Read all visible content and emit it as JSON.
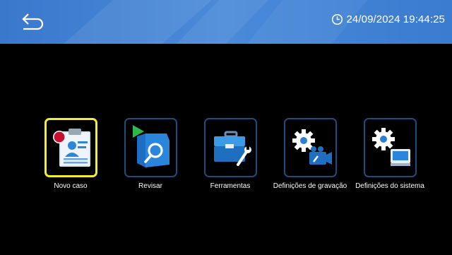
{
  "header": {
    "datetime": "24/09/2024 19:44:25"
  },
  "menu": {
    "items": [
      {
        "label": "Novo caso",
        "icon": "new-case-icon",
        "selected": true
      },
      {
        "label": "Revisar",
        "icon": "review-play-search-icon",
        "selected": false
      },
      {
        "label": "Ferramentas",
        "icon": "toolbox-wrench-icon",
        "selected": false
      },
      {
        "label": "Definições de gravação",
        "icon": "recording-settings-gear-camera-icon",
        "selected": false
      },
      {
        "label": "Definições do sistema",
        "icon": "system-settings-gear-monitor-icon",
        "selected": false
      }
    ]
  },
  "colors": {
    "header_blue": "#3d7fd2",
    "tile_border": "#1d4d7e",
    "selected_border": "#f4ee2f",
    "background": "#000000"
  }
}
